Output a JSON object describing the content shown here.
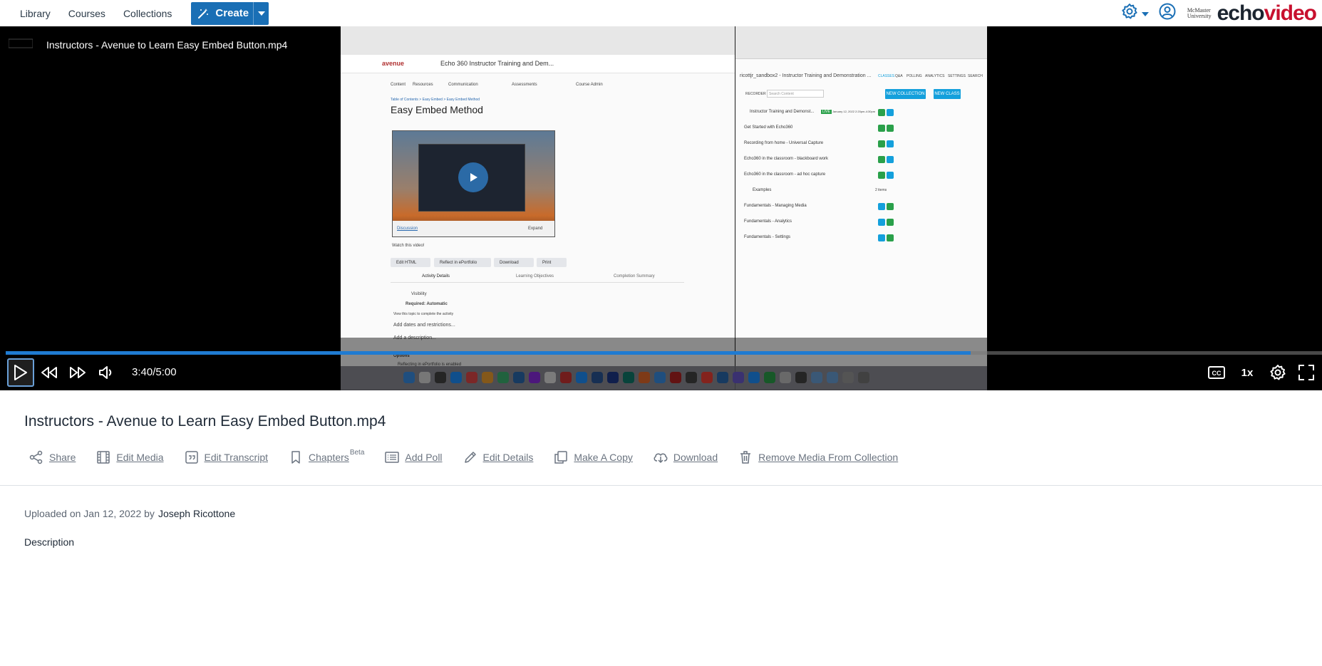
{
  "nav": {
    "library": "Library",
    "courses": "Courses",
    "collections": "Collections",
    "create": "Create",
    "brand_echo": "echo",
    "brand_video": "video",
    "university_line1": "McMaster",
    "university_line2": "University"
  },
  "player": {
    "title": "Instructors - Avenue to Learn Easy Embed Button.mp4",
    "time": "3:40/5:00",
    "progress_fraction": 0.7333,
    "speed": "1x",
    "cc_label": "CC"
  },
  "screen_content": {
    "lms_logo": "avenue",
    "lms_course": "Echo 360 Instructor Training and Dem...",
    "lms_menu": [
      "Content",
      "Resources",
      "Communication",
      "Assessments",
      "Course Admin"
    ],
    "breadcrumb": "Table of Contents > Easy Embed > Easy Embed Method",
    "page_heading": "Easy Embed Method",
    "discussion_link": "Discussion",
    "expand_label": "Expand",
    "watch_text": "Watch this video!",
    "buttons": [
      "Edit HTML",
      "Reflect in ePortfolio",
      "Download",
      "Print"
    ],
    "tabs": [
      "Activity Details",
      "Learning Objectives",
      "Completion Summary"
    ],
    "visibility": "Visibility",
    "required": "Required: Automatic",
    "view_text": "View this topic to complete the activity",
    "add_dates": "Add dates and restrictions...",
    "add_description": "Add a description...",
    "options": "Options",
    "reflecting": "Reflecting in ePortfolio is enabled",
    "echo_header": "ricottjr_sandbox2 - Instructor Training and Demonstration ...",
    "echo_tabs": [
      "CLASSES",
      "Q&A",
      "POLLING",
      "ANALYTICS",
      "SETTINGS",
      "SEARCH"
    ],
    "recorder": "RECORDER",
    "search_content": "Search Content",
    "new_collection": "NEW COLLECTION",
    "new_class": "NEW CLASS",
    "live_badge": "LIVE",
    "live_date": "January 12, 2022  2:20pm-4:30pm",
    "examples_count": "2 items",
    "class_rows": [
      "Instructor Training and Demonst...",
      "Get Started with Echo360",
      "Recording from home - Universal Capture",
      "Echo360 in the classroom - blackboard work",
      "Echo360 in the classroom - ad hoc capture",
      "Examples",
      "Fundamentals - Managing Media",
      "Fundamentals - Analytics",
      "Fundamentals - Settings"
    ]
  },
  "media": {
    "title": "Instructors - Avenue to Learn Easy Embed Button.mp4",
    "actions": {
      "share": "Share",
      "edit_media": "Edit Media",
      "edit_transcript": "Edit Transcript",
      "chapters": "Chapters",
      "chapters_badge": "Beta",
      "add_poll": "Add Poll",
      "edit_details": "Edit Details",
      "make_copy": "Make A Copy",
      "download": "Download",
      "remove": "Remove Media From Collection"
    },
    "uploaded_text": "Uploaded on Jan 12, 2022 by",
    "uploader": "Joseph Ricottone",
    "description_label": "Description"
  },
  "colors": {
    "accent": "#1a6fb5",
    "brand_red": "#c8102e",
    "progress": "#1f7bd1"
  }
}
